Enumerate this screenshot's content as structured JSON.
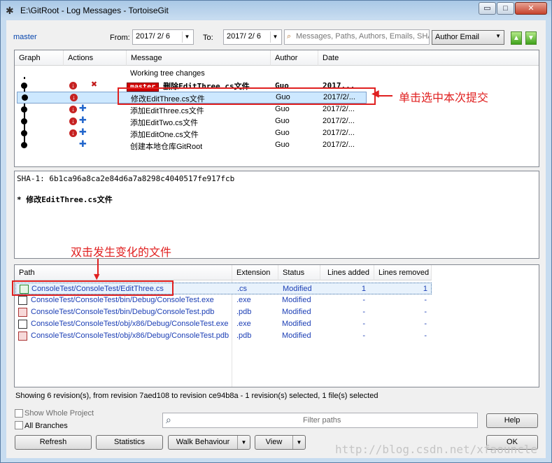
{
  "window": {
    "title": "E:\\GitRoot - Log Messages - TortoiseGit",
    "min_glyph": "▭",
    "max_glyph": "□",
    "close_glyph": "✕"
  },
  "filters": {
    "branch": "master",
    "from_label": "From:",
    "from_date": "2017/ 2/ 6",
    "to_label": "To:",
    "to_date": "2017/ 2/ 6",
    "search_placeholder": "Messages, Paths, Authors, Emails, SHA-1",
    "search_field": "Author Email",
    "up_glyph": "▲",
    "down_glyph": "▼"
  },
  "log": {
    "columns": [
      "Graph",
      "Actions",
      "Message",
      "Author",
      "Date"
    ],
    "rows": [
      {
        "message": "Working tree changes",
        "author": "",
        "date": "",
        "tag": ""
      },
      {
        "message": "删除EditThree.cs文件",
        "author": "Guo",
        "date": "2017...",
        "tag": "master"
      },
      {
        "message": "修改EditThree.cs文件",
        "author": "Guo",
        "date": "2017/2/...",
        "tag": ""
      },
      {
        "message": "添加EditThree.cs文件",
        "author": "Guo",
        "date": "2017/2/...",
        "tag": ""
      },
      {
        "message": "添加EditTwo.cs文件",
        "author": "Guo",
        "date": "2017/2/...",
        "tag": ""
      },
      {
        "message": "添加EditOne.cs文件",
        "author": "Guo",
        "date": "2017/2/...",
        "tag": ""
      },
      {
        "message": "创建本地仓库GitRoot",
        "author": "Guo",
        "date": "2017/2/...",
        "tag": ""
      }
    ]
  },
  "details": {
    "sha": "SHA-1: 6b1ca96a8ca2e84d6a7a8298c4040517fe917fcb",
    "message": "* 修改EditThree.cs文件"
  },
  "files": {
    "columns": [
      "Path",
      "Extension",
      "Status",
      "Lines added",
      "Lines removed"
    ],
    "rows": [
      {
        "path": "ConsoleTest/ConsoleTest/EditThree.cs",
        "ext": ".cs",
        "status": "Modified",
        "added": "1",
        "removed": "1"
      },
      {
        "path": "ConsoleTest/ConsoleTest/bin/Debug/ConsoleTest.exe",
        "ext": ".exe",
        "status": "Modified",
        "added": "-",
        "removed": "-"
      },
      {
        "path": "ConsoleTest/ConsoleTest/bin/Debug/ConsoleTest.pdb",
        "ext": ".pdb",
        "status": "Modified",
        "added": "-",
        "removed": "-"
      },
      {
        "path": "ConsoleTest/ConsoleTest/obj/x86/Debug/ConsoleTest.exe",
        "ext": ".exe",
        "status": "Modified",
        "added": "-",
        "removed": "-"
      },
      {
        "path": "ConsoleTest/ConsoleTest/obj/x86/Debug/ConsoleTest.pdb",
        "ext": ".pdb",
        "status": "Modified",
        "added": "-",
        "removed": "-"
      }
    ]
  },
  "status_bar": "Showing 6 revision(s), from revision 7aed108 to revision ce94b8a - 1 revision(s) selected, 1 file(s) selected",
  "options": {
    "show_whole_project": "Show Whole Project",
    "all_branches": "All Branches",
    "filter_paths_placeholder": "Filter paths"
  },
  "buttons": {
    "help": "Help",
    "refresh": "Refresh",
    "statistics": "Statistics",
    "walk_behaviour": "Walk Behaviour",
    "view": "View",
    "ok": "OK",
    "dropdown_glyph": "▼"
  },
  "annotations": {
    "select_commit": "单击选中本次提交",
    "double_click_file": "双击发生变化的文件"
  },
  "watermark": "http://blog.csdn.net/xfaouncle",
  "colors": {
    "annotation": "#e02020",
    "branch_tag": "#d10000",
    "file_link": "#1c3fb5",
    "selection": "#cde8ff"
  }
}
